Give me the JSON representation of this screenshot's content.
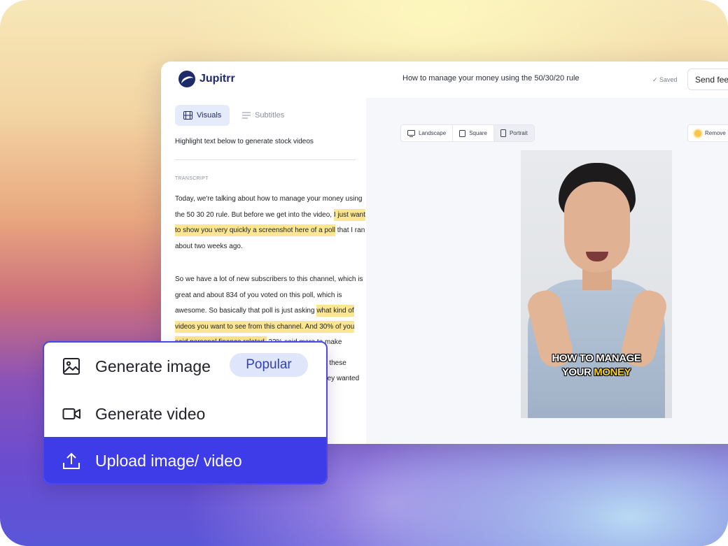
{
  "app": {
    "logo_text": "Jupitrr",
    "doc_title": "How to manage your money using the 50/30/20 rule",
    "saved_text": "✓ Saved",
    "feedback_label": "Send feedback"
  },
  "left": {
    "tabs": [
      {
        "label": "Visuals"
      },
      {
        "label": "Subtitles"
      }
    ],
    "hint": "Highlight text below to generate stock videos",
    "transcript_label": "TRANSCRIPT",
    "p1_a": "Today, we're talking about how to manage your money using the 50 30 20 rule. But before we get into the video, ",
    "p1_hl": "I just want to show you very quickly a screenshot here of a poll",
    "p1_b": " that I ran about two weeks ago.",
    "p2_a": "So we have a lot of new subscribers to this channel, which is great and about 834 of you voted on this poll, which is awesome. So basically that poll is just asking ",
    "p2_hl": "what kind of videos you want to see from this channel. And 30% of you said personal finance related,",
    "p2_b": " 22% said more to make",
    "p3_a": "e these",
    "p3_b": "ney wanted"
  },
  "right": {
    "orientations": [
      {
        "label": "Landscape"
      },
      {
        "label": "Square"
      },
      {
        "label": "Portrait"
      }
    ],
    "remove_label": "Remove",
    "caption_line1": "HOW TO MANAGE",
    "caption_line2_a": "YOUR ",
    "caption_line2_b": "MONEY"
  },
  "menu": {
    "items": [
      {
        "label": "Generate image",
        "icon": "image-icon"
      },
      {
        "label": "Generate video",
        "icon": "video-camera-icon"
      },
      {
        "label": "Upload image/ video",
        "icon": "upload-icon"
      }
    ],
    "badge": "Popular"
  },
  "colors": {
    "accent": "#3d3ce8",
    "highlight": "#fbe793",
    "caption_accent": "#f7d21e"
  }
}
